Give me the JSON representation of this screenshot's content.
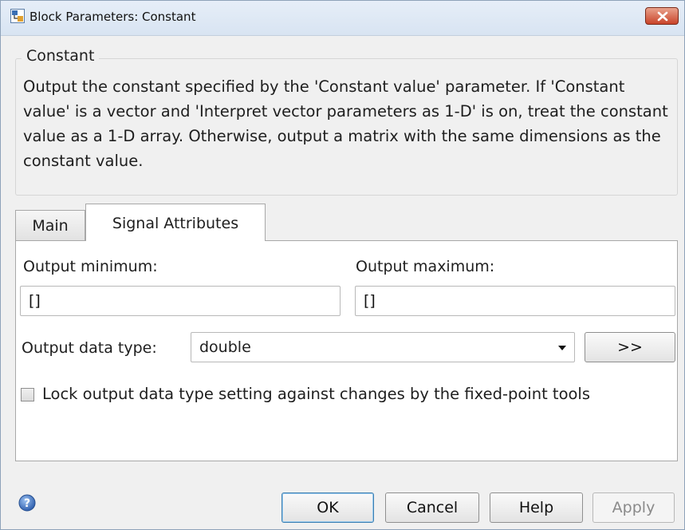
{
  "window": {
    "title": "Block Parameters: Constant"
  },
  "block": {
    "name": "Constant",
    "description": "Output the constant specified by the 'Constant value' parameter. If 'Constant value' is a vector and 'Interpret vector parameters as 1-D' is on, treat the constant value as a 1-D array. Otherwise, output a matrix with the same dimensions as the constant value."
  },
  "tabs": [
    {
      "label": "Main",
      "active": false
    },
    {
      "label": "Signal Attributes",
      "active": true
    }
  ],
  "signal_attributes": {
    "output_minimum_label": "Output minimum:",
    "output_minimum_value": "[]",
    "output_maximum_label": "Output maximum:",
    "output_maximum_value": "[]",
    "output_data_type_label": "Output data type:",
    "output_data_type_value": "double",
    "assistant_button_label": ">>",
    "lock_checkbox_label": "Lock output data type setting against changes by the fixed-point tools",
    "lock_checked": false
  },
  "buttons": {
    "ok": "OK",
    "cancel": "Cancel",
    "help": "Help",
    "apply": "Apply"
  },
  "icons": [
    "block-parameters-icon",
    "close-icon",
    "dropdown-arrow-icon",
    "help-question-icon"
  ],
  "colors": {
    "close_button": "#c9442a",
    "help_icon": "#3f74c8",
    "title_bar": "#dce7f4"
  }
}
